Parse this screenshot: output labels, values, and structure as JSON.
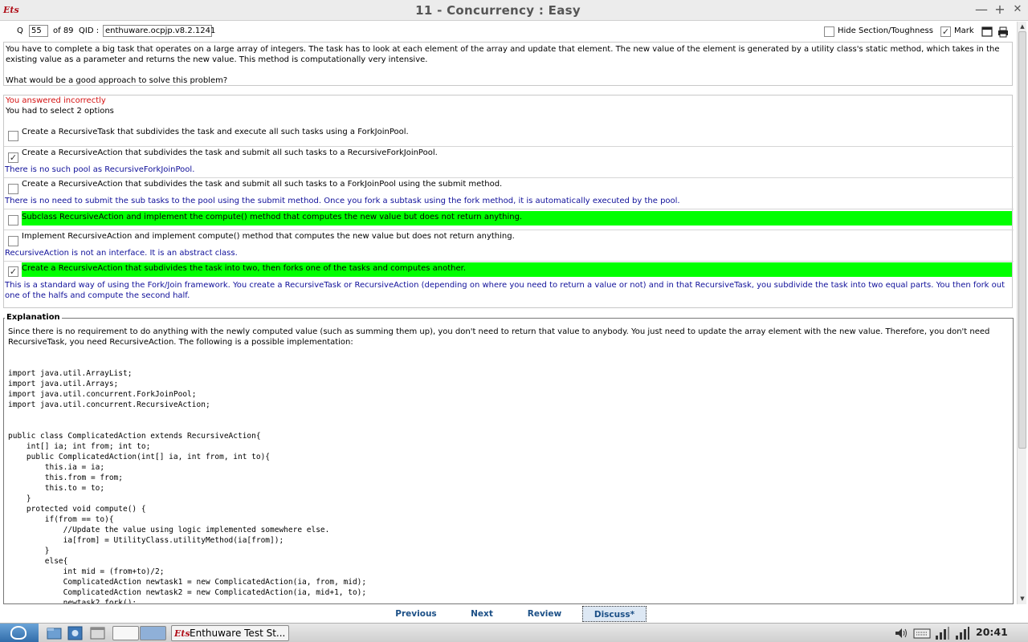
{
  "window": {
    "title": "11 - Concurrency  :  Easy",
    "app_logo": "Ets",
    "minimize": "—",
    "maximize": "+",
    "close": "✕"
  },
  "toolbar": {
    "q_label": "Q",
    "q_number": "55",
    "of_total": "of 89",
    "qid_label": "QID :",
    "qid_value": "enthuware.ocpjp.v8.2.1241",
    "hide_section_label": "Hide Section/Toughness",
    "hide_section_checked": false,
    "mark_label": "Mark",
    "mark_checked": true
  },
  "question": {
    "text": "You have to complete a big task that operates on a large array of integers. The task has to look at each element of the array and update that element. The new value of the element is generated by a utility class's static method, which takes in the existing value as a parameter and returns the new value. This method is computationally very intensive.",
    "prompt": "What would be a good approach to solve this problem?"
  },
  "answers": {
    "status": "You answered incorrectly",
    "instruction": "You had to select 2 options",
    "options": [
      {
        "text": "Create a RecursiveTask that subdivides the task and execute all such tasks using a ForkJoinPool.",
        "checked": false,
        "correct": false,
        "note": ""
      },
      {
        "text": "Create a RecursiveAction that subdivides the task and submit all such tasks to a RecursiveForkJoinPool.",
        "checked": true,
        "correct": false,
        "note": "There is no such pool as RecursiveForkJoinPool."
      },
      {
        "text": "Create a RecursiveAction that subdivides the task and submit all such tasks to a ForkJoinPool using the submit method.",
        "checked": false,
        "correct": false,
        "note": "There is no need to submit the sub tasks to the pool using the submit method. Once you fork a subtask using the fork method, it is automatically executed by the pool."
      },
      {
        "text": "Subclass RecursiveAction and implement the compute() method that computes the new value but does not return anything.",
        "checked": false,
        "correct": true,
        "note": ""
      },
      {
        "text": "Implement RecursiveAction and implement compute() method that computes the new value but does not return anything.",
        "checked": false,
        "correct": false,
        "note": "RecursiveAction is not an interface. It is an abstract class."
      },
      {
        "text": "Create a RecursiveAction that subdivides the task into two, then forks one of the tasks and computes another.",
        "checked": true,
        "correct": true,
        "note": "This is a standard way of using the Fork/Join framework. You create a RecursiveTask or RecursiveAction (depending on where you need to return a value or not) and in that RecursiveTask, you subdivide the task into two equal parts. You then fork out one of the halfs and compute the second half."
      }
    ]
  },
  "explanation": {
    "title": "Explanation",
    "text": "Since there is no requirement to do anything with the newly computed value (such as summing them up), you don't need to return that value to anybody. You just need to update the array element with the new value. Therefore, you don't need RecursiveTask, you need RecursiveAction. The following is a possible implementation:",
    "code": "import java.util.ArrayList;\nimport java.util.Arrays;\nimport java.util.concurrent.ForkJoinPool;\nimport java.util.concurrent.RecursiveAction;\n\n\npublic class ComplicatedAction extends RecursiveAction{\n    int[] ia; int from; int to;\n    public ComplicatedAction(int[] ia, int from, int to){\n        this.ia = ia;\n        this.from = from;\n        this.to = to;\n    }\n    protected void compute() {\n        if(from == to){\n            //Update the value using logic implemented somewhere else.\n            ia[from] = UtilityClass.utilityMethod(ia[from]);\n        }\n        else{\n            int mid = (from+to)/2;\n            ComplicatedAction newtask1 = new ComplicatedAction(ia, from, mid);\n            ComplicatedAction newtask2 = new ComplicatedAction(ia, mid+1, to);\n            newtask2.fork();"
  },
  "nav": {
    "previous": "Previous",
    "next": "Next",
    "review": "Review",
    "discuss": "Discuss*"
  },
  "taskbar": {
    "task_label": "Enthuware Test St...",
    "task_logo": "Ets",
    "clock": "20:41"
  }
}
